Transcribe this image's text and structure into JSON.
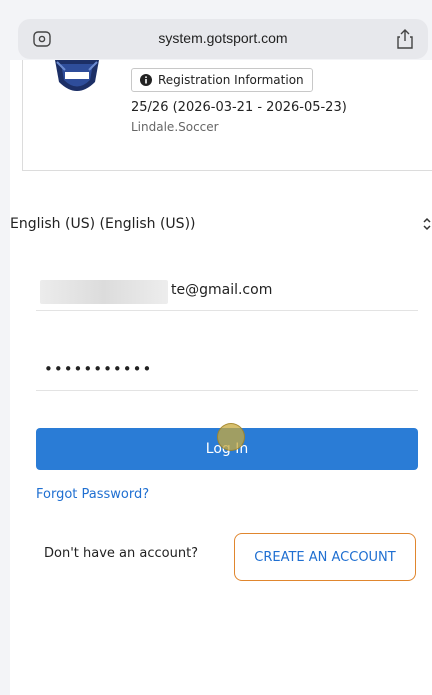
{
  "browser": {
    "url": "system.gotsport.com",
    "icons": {
      "left": "site-settings-icon",
      "right": "share-icon"
    }
  },
  "event": {
    "registration_button_label": "Registration Information",
    "dates": "25/26 (2026-03-21 - 2026-05-23)",
    "club": "Lindale.Soccer"
  },
  "language": {
    "selected": "English (US) (English (US))"
  },
  "login_form": {
    "email_value": "te@gmail.com",
    "password_value": "•••••••••••",
    "login_label": "Log In",
    "forgot_password_label": "Forgot Password?",
    "signup_prompt": "Don't have an account?",
    "create_account_label": "CREATE AN ACCOUNT"
  },
  "colors": {
    "primary": "#2a7cd6",
    "link": "#1f6fd1",
    "highlight": "#e0862e"
  }
}
